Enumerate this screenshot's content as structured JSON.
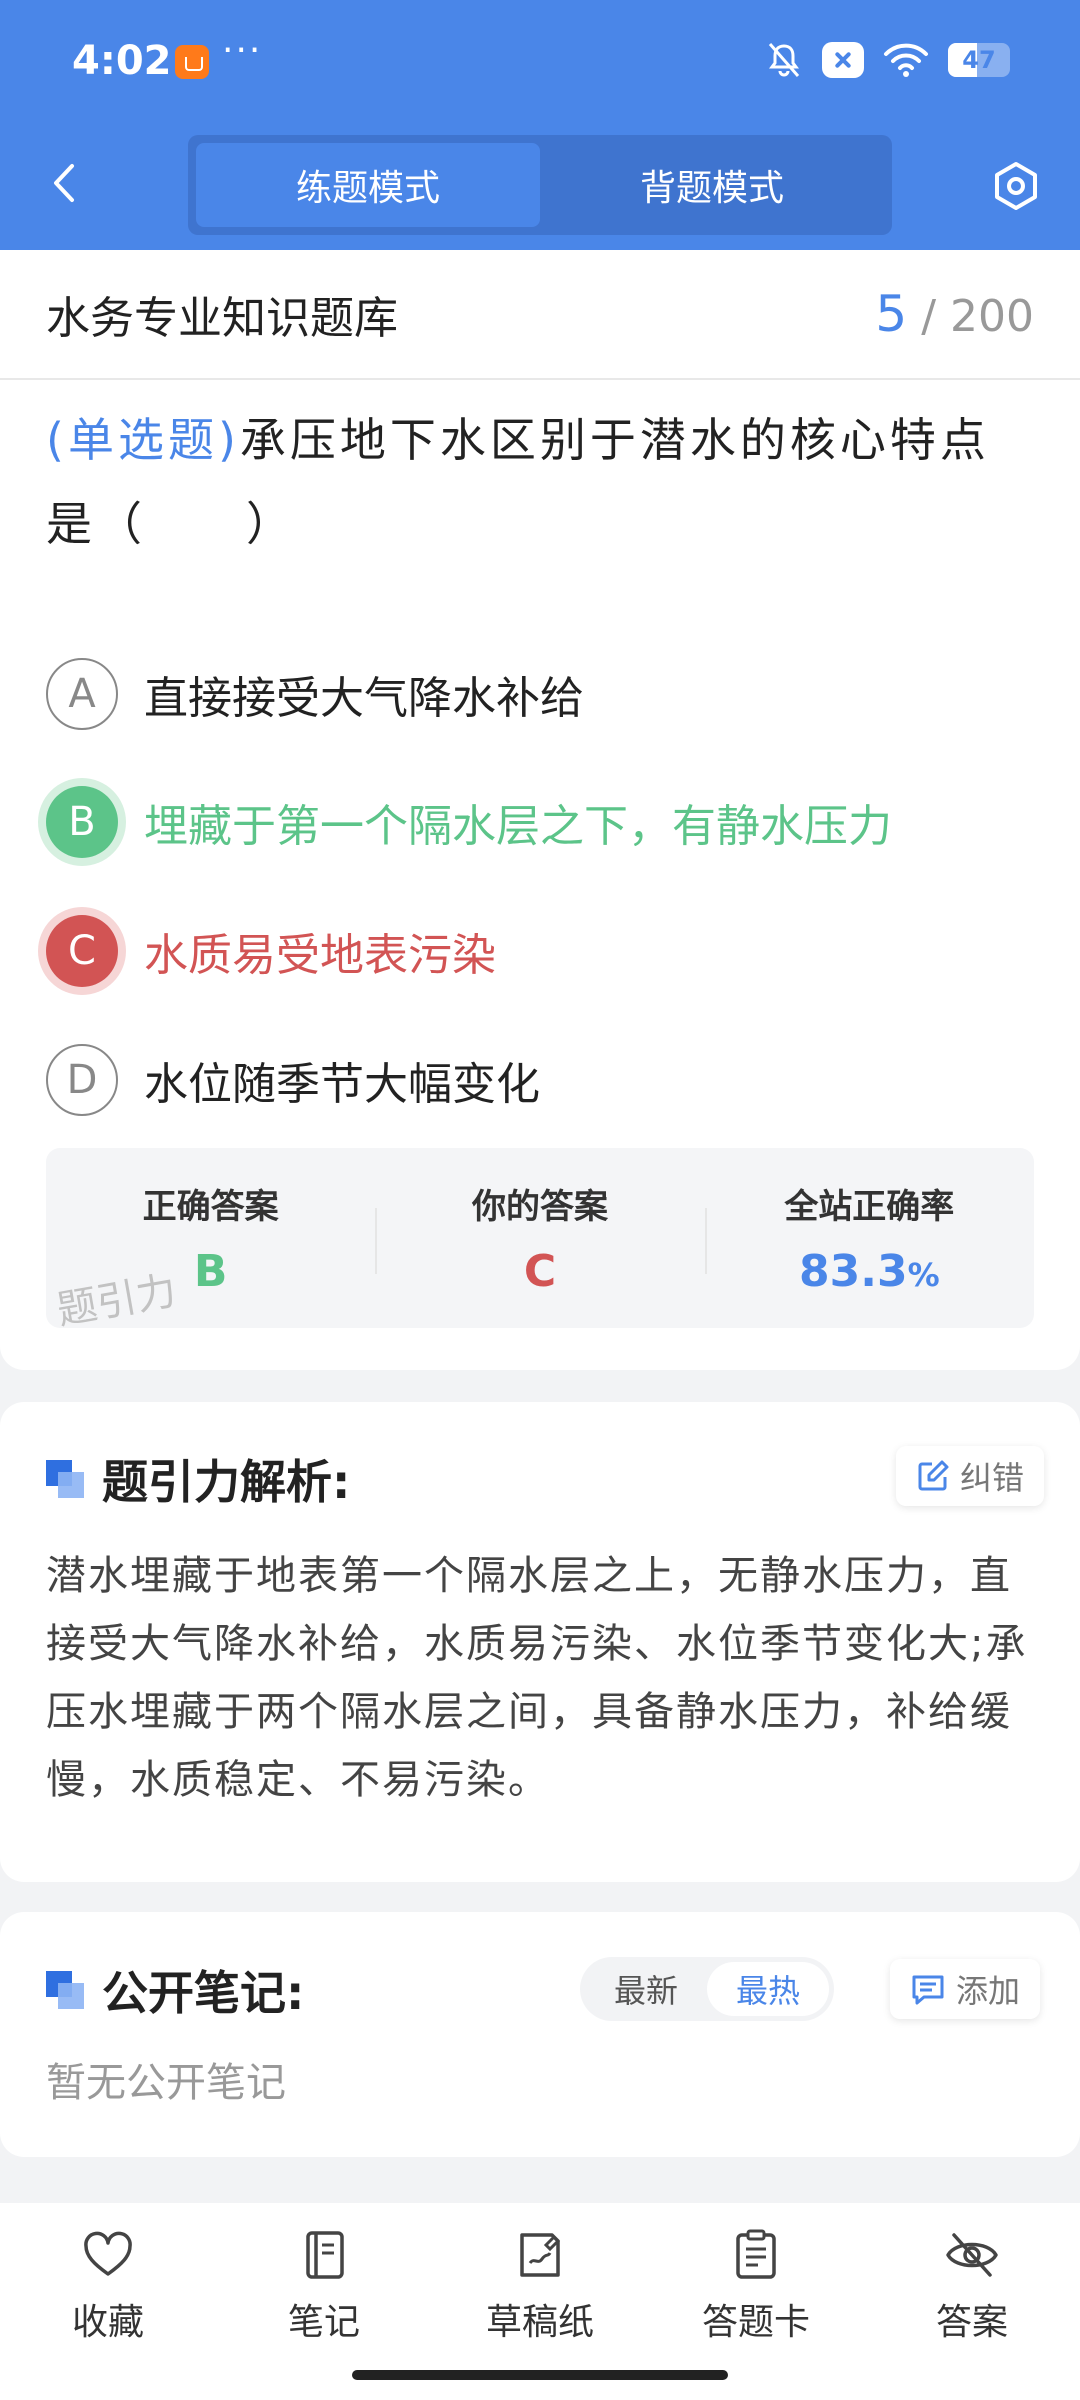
{
  "status_bar": {
    "time": "4:02",
    "more": "···",
    "battery": "47",
    "battery_level": 0.47
  },
  "header": {
    "tabs": [
      {
        "label": "练题模式",
        "active": true
      },
      {
        "label": "背题模式",
        "active": false
      }
    ]
  },
  "question": {
    "bank_title": "水务专业知识题库",
    "current": "5",
    "total": "/ 200",
    "type": "(单选题)",
    "text": "承压地下水区别于潜水的核心特点是（　　）",
    "options": [
      {
        "letter": "A",
        "text": "直接接受大气降水补给",
        "state": "normal"
      },
      {
        "letter": "B",
        "text": "埋藏于第一个隔水层之下，有静水压力",
        "state": "correct"
      },
      {
        "letter": "C",
        "text": "水质易受地表污染",
        "state": "wrong"
      },
      {
        "letter": "D",
        "text": "水位随季节大幅变化",
        "state": "normal"
      }
    ]
  },
  "stats": {
    "correct_label": "正确答案",
    "correct_value": "B",
    "yours_label": "你的答案",
    "yours_value": "C",
    "rate_label": "全站正确率",
    "rate_value": "83.3",
    "rate_unit": "%",
    "watermark": "题引力"
  },
  "analysis": {
    "title": "题引力解析:",
    "report_label": "纠错",
    "text": "潜水埋藏于地表第一个隔水层之上，无静水压力，直接受大气降水补给，水质易污染、水位季节变化大;承压水埋藏于两个隔水层之间，具备静水压力，补给缓慢，水质稳定、不易污染。"
  },
  "notes": {
    "title": "公开笔记:",
    "sort_latest": "最新",
    "sort_hot": "最热",
    "add_label": "添加",
    "empty": "暂无公开笔记"
  },
  "bottom_nav": [
    {
      "label": "收藏",
      "icon": "heart-icon"
    },
    {
      "label": "笔记",
      "icon": "notebook-icon"
    },
    {
      "label": "草稿纸",
      "icon": "draft-paper-icon"
    },
    {
      "label": "答题卡",
      "icon": "answer-card-icon"
    },
    {
      "label": "答案",
      "icon": "eye-off-icon"
    }
  ],
  "colors": {
    "primary": "#4a86e8",
    "correct": "#5cc489",
    "wrong": "#d25454"
  }
}
